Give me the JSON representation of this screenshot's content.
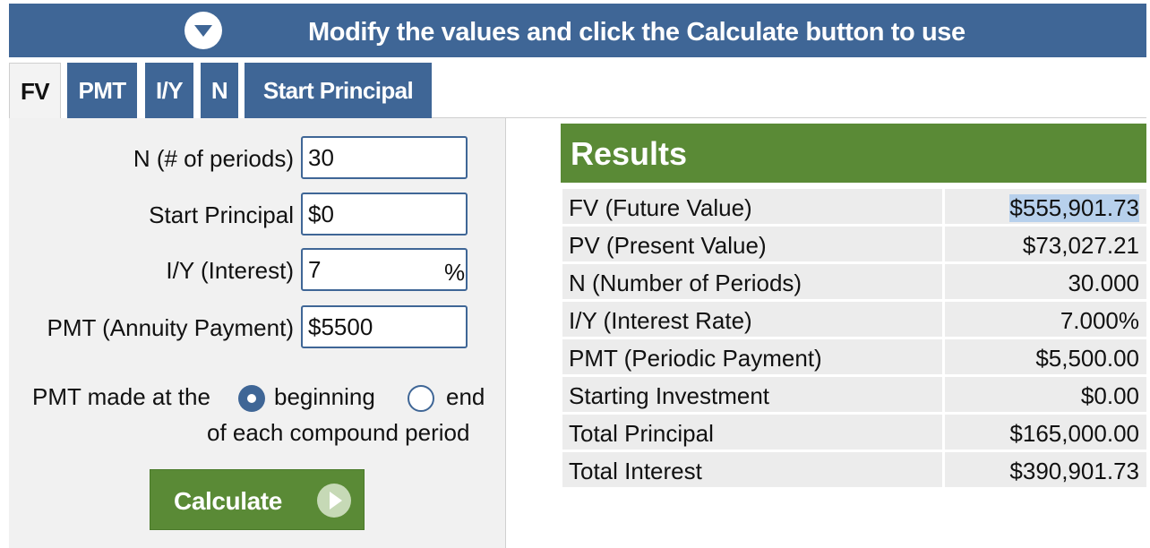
{
  "banner": {
    "message": "Modify the values and click the Calculate button to use",
    "icon": "chevron-down-circle-icon"
  },
  "tabs": [
    {
      "label": "FV",
      "active": true
    },
    {
      "label": "PMT",
      "active": false
    },
    {
      "label": "I/Y",
      "active": false
    },
    {
      "label": "N",
      "active": false
    },
    {
      "label": "Start Principal",
      "active": false
    }
  ],
  "form": {
    "n_label": "N (# of periods)",
    "n_value": "30",
    "principal_label": "Start Principal",
    "principal_value": "$0",
    "interest_label": "I/Y (Interest)",
    "interest_value": "7",
    "interest_unit": "%",
    "pmt_label": "PMT (Annuity Payment)",
    "pmt_value": "$5500",
    "timing_prefix": "PMT made at the",
    "timing_option_beginning": "beginning",
    "timing_option_end": "end",
    "timing_suffix": "of each compound period",
    "timing_selected": "beginning",
    "calculate_label": "Calculate"
  },
  "results": {
    "title": "Results",
    "rows": [
      {
        "label": "FV (Future Value)",
        "value": "$555,901.73"
      },
      {
        "label": "PV (Present Value)",
        "value": "$73,027.21"
      },
      {
        "label": "N (Number of Periods)",
        "value": "30.000"
      },
      {
        "label": "I/Y (Interest Rate)",
        "value": "7.000%"
      },
      {
        "label": "PMT (Periodic Payment)",
        "value": "$5,500.00"
      },
      {
        "label": "Starting Investment",
        "value": "$0.00"
      },
      {
        "label": "Total Principal",
        "value": "$165,000.00"
      },
      {
        "label": "Total Interest",
        "value": "$390,901.73"
      }
    ]
  },
  "colors": {
    "header_blue": "#3f6696",
    "accent_green": "#5a8a36",
    "row_gray": "#ececec"
  }
}
